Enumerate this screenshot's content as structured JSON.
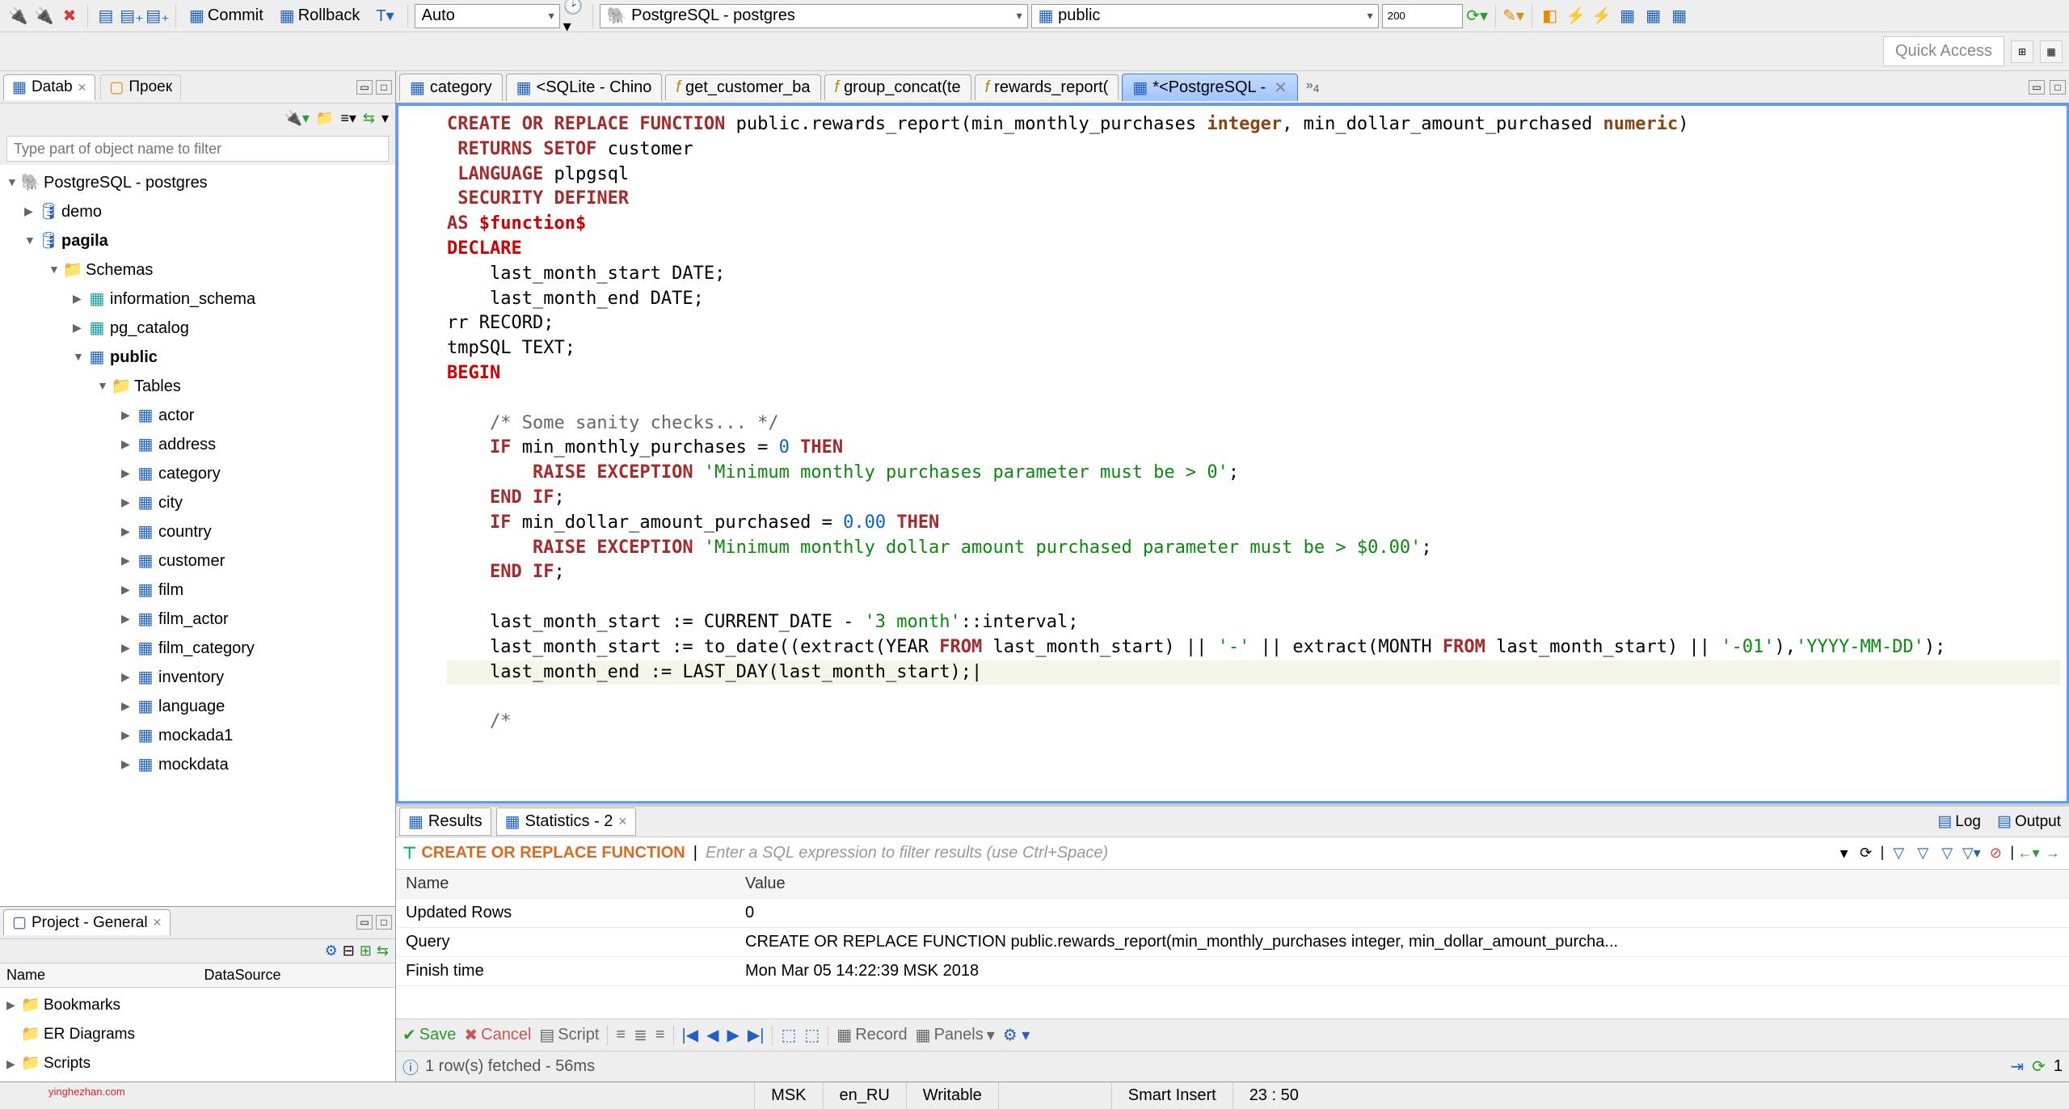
{
  "toolbar": {
    "commit": "Commit",
    "rollback": "Rollback",
    "auto": "Auto",
    "connection": "PostgreSQL - postgres",
    "schema": "public",
    "limit": "200"
  },
  "quickAccess": "Quick Access",
  "leftViews": {
    "tab1": "Datab",
    "tab2": "Проек"
  },
  "filterPlaceholder": "Type part of object name to filter",
  "dbTree": {
    "conn": "PostgreSQL - postgres",
    "db1": "demo",
    "db2": "pagila",
    "schemas": "Schemas",
    "s1": "information_schema",
    "s2": "pg_catalog",
    "s3": "public",
    "tables": "Tables",
    "t": [
      "actor",
      "address",
      "category",
      "city",
      "country",
      "customer",
      "film",
      "film_actor",
      "film_category",
      "inventory",
      "language",
      "mockada1",
      "mockdata"
    ]
  },
  "projectView": {
    "title": "Project - General",
    "colName": "Name",
    "colDS": "DataSource",
    "items": [
      "Bookmarks",
      "ER Diagrams",
      "Scripts"
    ]
  },
  "editorTabs": {
    "t1": "category",
    "t2": "<SQLite - Chino",
    "t3": "get_customer_ba",
    "t4": "group_concat(te",
    "t5": "rewards_report(",
    "t6": "*<PostgreSQL -",
    "more": "»",
    "moreSub": "4"
  },
  "sql": {
    "l1a": "CREATE OR REPLACE FUNCTION",
    "l1b": " public.rewards_report(min_monthly_purchases ",
    "l1c": "integer",
    "l1d": ", min_dollar_amount_purchased ",
    "l1e": "numeric",
    "l1f": ")",
    "l2a": " RETURNS SETOF",
    "l2b": " customer",
    "l3a": " LANGUAGE",
    "l3b": " plpgsql",
    "l4": " SECURITY DEFINER",
    "l5a": "AS ",
    "l5b": "$function$",
    "l6": "DECLARE",
    "l7": "    last_month_start DATE;",
    "l8": "    last_month_end DATE;",
    "l9": "rr RECORD;",
    "l10": "tmpSQL TEXT;",
    "l11": "BEGIN",
    "l12": "",
    "l13": "    /* Some sanity checks... */",
    "l14a": "    IF",
    "l14b": " min_monthly_purchases = ",
    "l14c": "0",
    "l14d": " THEN",
    "l15a": "        RAISE EXCEPTION ",
    "l15b": "'Minimum monthly purchases parameter must be > 0'",
    "l15c": ";",
    "l16a": "    END",
    "l16b": " IF",
    "l16c": ";",
    "l17a": "    IF",
    "l17b": " min_dollar_amount_purchased = ",
    "l17c": "0.00",
    "l17d": " THEN",
    "l18a": "        RAISE EXCEPTION ",
    "l18b": "'Minimum monthly dollar amount purchased parameter must be > $0.00'",
    "l18c": ";",
    "l19a": "    END",
    "l19b": " IF",
    "l19c": ";",
    "l20": "",
    "l21a": "    last_month_start := CURRENT_DATE - ",
    "l21b": "'3 month'",
    "l21c": "::interval;",
    "l22a": "    last_month_start := to_date((extract(YEAR ",
    "l22b": "FROM",
    "l22c": " last_month_start) || ",
    "l22d": "'-'",
    "l22e": " || extract(MONTH ",
    "l22f": "FROM",
    "l22g": " last_month_start) || ",
    "l22h": "'-01'",
    "l22i": "),",
    "l22j": "'YYYY-MM-DD'",
    "l22k": ");",
    "l23": "    last_month_end := LAST_DAY(last_month_start);",
    "l24": "",
    "l25": "    /*"
  },
  "results": {
    "tab1": "Results",
    "tab2": "Statistics - 2",
    "log": "Log",
    "output": "Output",
    "filterLabel": "CREATE OR REPLACE FUNCTION",
    "filterHint": "Enter a SQL expression to filter results (use Ctrl+Space)",
    "hName": "Name",
    "hValue": "Value",
    "rows": [
      {
        "n": "Updated Rows",
        "v": "0"
      },
      {
        "n": "Query",
        "v": "CREATE OR REPLACE FUNCTION public.rewards_report(min_monthly_purchases integer, min_dollar_amount_purcha..."
      },
      {
        "n": "Finish time",
        "v": "Mon Mar 05 14:22:39 MSK 2018"
      }
    ],
    "save": "Save",
    "cancel": "Cancel",
    "script": "Script",
    "record": "Record",
    "panels": "Panels",
    "fetchMsg": "1 row(s) fetched - 56ms",
    "rownum": "1"
  },
  "bottomStatus": {
    "tz": "MSK",
    "locale": "en_RU",
    "writable": "Writable",
    "insert": "Smart Insert",
    "pos": "23 : 50"
  },
  "watermark": "yinghezhan.com"
}
